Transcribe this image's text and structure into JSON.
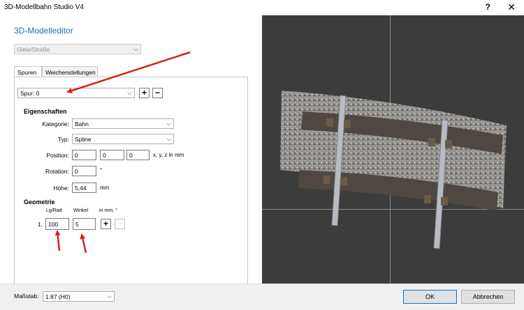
{
  "window": {
    "title": "3D-Modellbahn Studio V4",
    "help_label": "?",
    "close_label": "✕"
  },
  "editor": {
    "heading": "3D-Modelleditor",
    "category_select": {
      "value": "Gleis/Straße"
    },
    "tabs": [
      {
        "label": "Spuren"
      },
      {
        "label": "Weichenstellungen"
      }
    ],
    "track_select": {
      "value": "Spur: 0"
    },
    "add_label": "+",
    "remove_label": "−",
    "properties": {
      "heading": "Eigenschaften",
      "kategorie_label": "Kategorie:",
      "kategorie_value": "Bahn",
      "typ_label": "Typ:",
      "typ_value": "Spline",
      "position_label": "Position:",
      "position_x": "0",
      "position_y": "0",
      "position_z": "0",
      "position_unit": "x, y, z in mm",
      "rotation_label": "Rotation:",
      "rotation_value": "0",
      "rotation_unit": "°",
      "hoehe_label": "Höhe:",
      "hoehe_value": "5,44",
      "hoehe_unit": "mm"
    },
    "geometry": {
      "heading": "Geometrie",
      "col_lg_rad": "Lg/Rad",
      "col_winkel": "Winkel",
      "col_unit": "in mm, °",
      "rows": [
        {
          "index": "1.",
          "lg_rad": "100",
          "winkel": "5"
        }
      ],
      "add_label": "+",
      "more_label": "···"
    }
  },
  "footer": {
    "scale_label": "Maßstab:",
    "scale_value": "1:87 (H0)",
    "ok_label": "OK",
    "cancel_label": "Abbrechen"
  },
  "colors": {
    "accent": "#2a6aa8",
    "annotation_arrow": "#d42020",
    "viewport_bg": "#3c3c3c"
  },
  "icons": {
    "dropdown": "chevron-down-icon",
    "close": "close-icon",
    "help": "help-icon"
  }
}
